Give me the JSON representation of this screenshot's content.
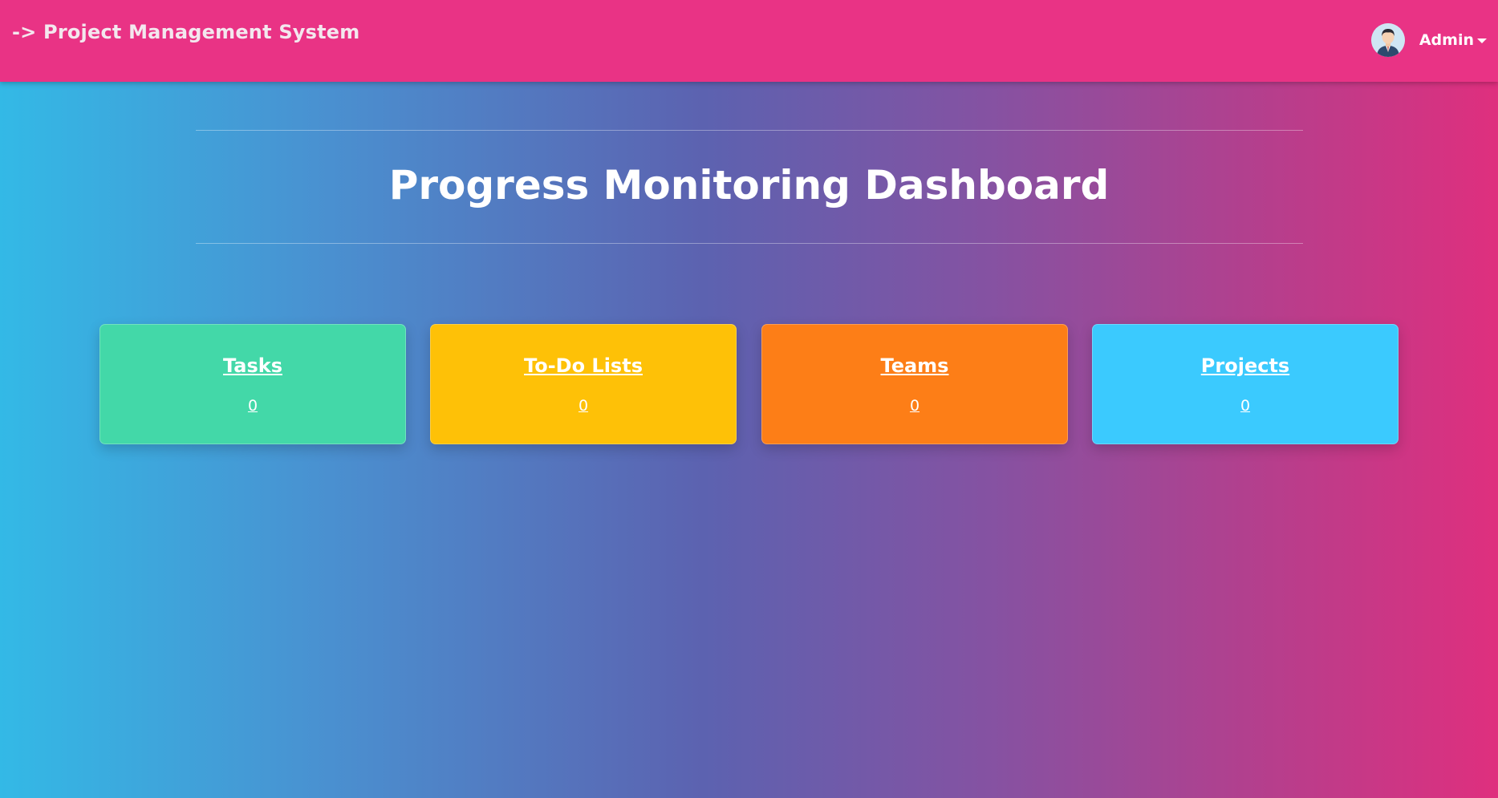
{
  "navbar": {
    "brand": "-> Project Management System",
    "user": {
      "name": "Admin",
      "avatar_icon": "user-avatar-icon"
    },
    "background_color": "#e93385"
  },
  "main": {
    "title": "Progress Monitoring Dashboard",
    "cards": [
      {
        "title": "Tasks",
        "count": "0",
        "color": "#43d8a8"
      },
      {
        "title": "To-Do Lists",
        "count": "0",
        "color": "#fec107"
      },
      {
        "title": "Teams",
        "count": "0",
        "color": "#fd7e17"
      },
      {
        "title": "Projects",
        "count": "0",
        "color": "#3bcafe"
      }
    ]
  }
}
